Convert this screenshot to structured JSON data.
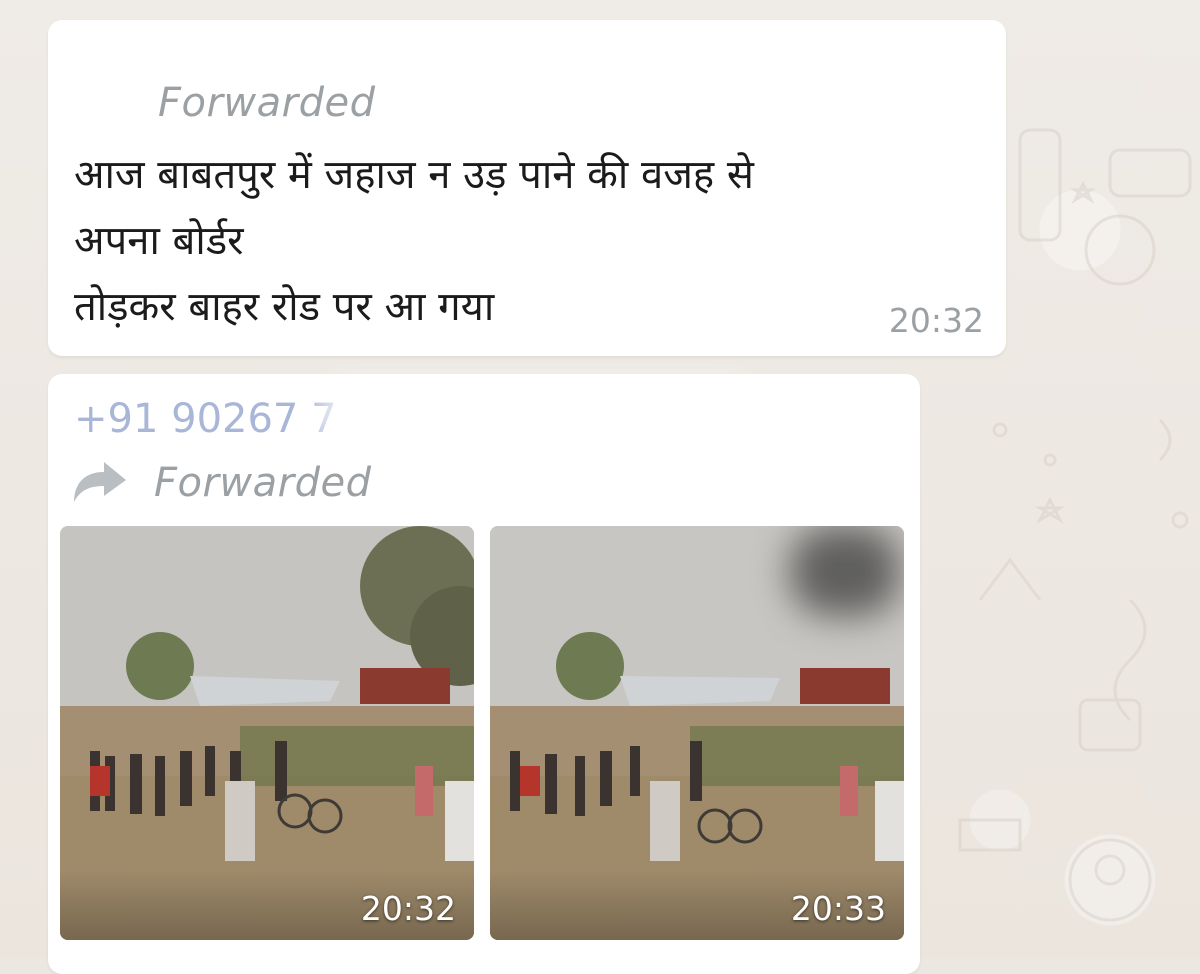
{
  "chat": {
    "message_1": {
      "forwarded_label": "Forwarded",
      "text": "आज बाबतपुर में जहाज न उड़ पाने की वजह से\nअपना बोर्डर\n तोड़कर बाहर रोड पर आ गया",
      "time": "20:32"
    },
    "message_2": {
      "sender": "+91 90267 7",
      "forwarded_label": "Forwarded",
      "forward_icon": "forward-arrow-icon",
      "photos": [
        {
          "time": "20:32"
        },
        {
          "time": "20:33"
        }
      ]
    }
  },
  "colors": {
    "bubble": "#ffffff",
    "wallpaper": "#ece7e1",
    "meta_text": "#9aa0a4",
    "sender_text": "#a9b6d8"
  }
}
